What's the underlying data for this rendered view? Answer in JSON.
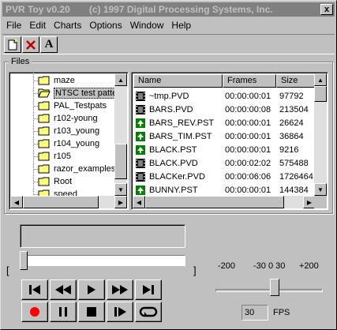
{
  "window": {
    "title": "PVR Toy v0.20",
    "copyright": "(c) 1997 Digital Processing Systems, Inc.",
    "close_glyph": "x"
  },
  "menu": [
    "File",
    "Edit",
    "Charts",
    "Options",
    "Window",
    "Help"
  ],
  "toolbar": {
    "font_glyph": "A"
  },
  "files_group": {
    "label": "Files"
  },
  "tree": {
    "items": [
      {
        "label": "maze",
        "open": false
      },
      {
        "label": "NTSC test patte",
        "open": true,
        "selected": true
      },
      {
        "label": "PAL_Testpats",
        "open": false
      },
      {
        "label": "r102-young",
        "open": false
      },
      {
        "label": "r103_young",
        "open": false
      },
      {
        "label": "r104_young",
        "open": false
      },
      {
        "label": "r105",
        "open": false
      },
      {
        "label": "razor_examples",
        "open": false
      },
      {
        "label": "Root",
        "open": false
      },
      {
        "label": "speed",
        "open": false
      }
    ]
  },
  "file_list": {
    "headers": [
      "Name",
      "Frames",
      "Size"
    ],
    "rows": [
      {
        "icon": "film",
        "name": "~tmp.PVD",
        "frames": "00:00:00:01",
        "size": "97792"
      },
      {
        "icon": "film",
        "name": "BARS.PVD",
        "frames": "00:00:00:08",
        "size": "213504"
      },
      {
        "icon": "still",
        "name": "BARS_REV.PST",
        "frames": "00:00:00:01",
        "size": "26624"
      },
      {
        "icon": "still",
        "name": "BARS_TIM.PST",
        "frames": "00:00:00:01",
        "size": "36864"
      },
      {
        "icon": "still",
        "name": "BLACK.PST",
        "frames": "00:00:00:01",
        "size": "9216"
      },
      {
        "icon": "film",
        "name": "BLACK.PVD",
        "frames": "00:00:02:02",
        "size": "575488"
      },
      {
        "icon": "film",
        "name": "BLACKer.PVD",
        "frames": "00:00:06:06",
        "size": "1726464"
      },
      {
        "icon": "still",
        "name": "BUNNY.PST",
        "frames": "00:00:00:01",
        "size": "144384"
      }
    ]
  },
  "transport": {
    "row1": [
      "skip-start-icon",
      "rewind-icon",
      "play-icon",
      "fast-forward-icon",
      "skip-end-icon"
    ],
    "row2": [
      "record-icon",
      "pause-icon",
      "stop-icon",
      "step-forward-icon",
      "loop-icon"
    ],
    "record_color": "#ff0000"
  },
  "position": {
    "left_bracket": "[",
    "right_bracket": "]",
    "value": 0
  },
  "speed": {
    "label_min": "-200",
    "label_mid": "-30 0 30",
    "label_max": "+200",
    "value": 0
  },
  "fps": {
    "value": "30",
    "label": "FPS"
  }
}
